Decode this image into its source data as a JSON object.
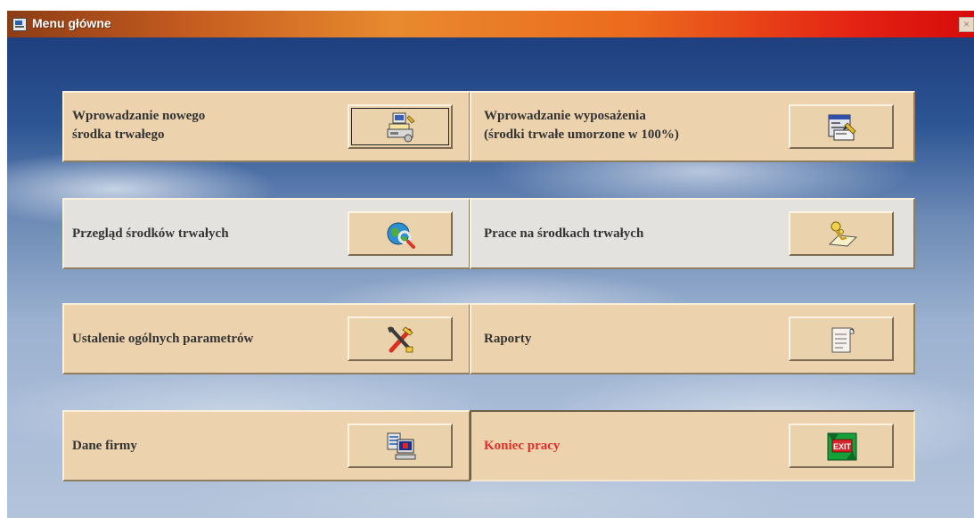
{
  "window": {
    "title": "Menu główne",
    "close_glyph": "×"
  },
  "menu": {
    "row1_left": {
      "line1": "Wprowadzanie nowego",
      "line2": "środka trwałego",
      "icon": "computer-entry-icon"
    },
    "row1_right": {
      "line1": "Wprowadzanie wyposażenia",
      "line2": "(środki trwałe umorzone w 100%)",
      "icon": "form-edit-icon"
    },
    "row2_left": {
      "label": "Przegląd środków trwałych",
      "icon": "globe-search-icon"
    },
    "row2_right": {
      "label": "Prace na środkach trwałych",
      "icon": "hand-pointer-icon"
    },
    "row3_left": {
      "label": "Ustalenie ogólnych parametrów",
      "icon": "tools-icon"
    },
    "row3_right": {
      "label": "Raporty",
      "icon": "document-scroll-icon"
    },
    "row4_left": {
      "label": "Dane firmy",
      "icon": "company-computer-icon"
    },
    "row4_right": {
      "label": "Koniec pracy",
      "icon": "exit-icon",
      "exit_text": "EXIT"
    }
  },
  "colors": {
    "tile_beige": "#ecd3ad",
    "tile_gray": "#e3e2df",
    "exit_label": "#e0302e",
    "title_gradient_end": "#d60c0c"
  }
}
